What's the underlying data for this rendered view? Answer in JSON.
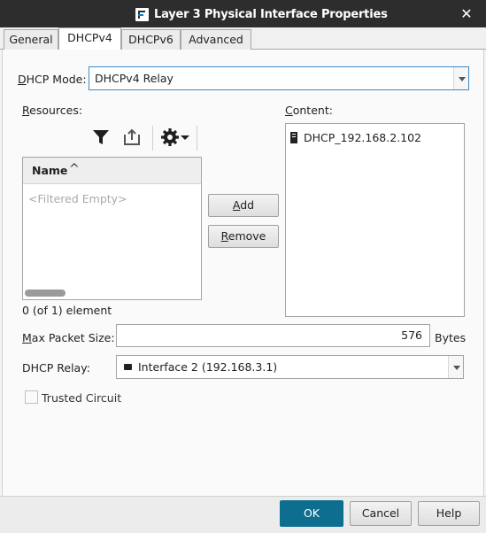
{
  "window": {
    "title": "Layer 3 Physical Interface Properties",
    "close_glyph": "✕"
  },
  "tabs": [
    {
      "label": "General",
      "active": false
    },
    {
      "label": "DHCPv4",
      "active": true
    },
    {
      "label": "DHCPv6",
      "active": false
    },
    {
      "label": "Advanced",
      "active": false
    }
  ],
  "dhcp_mode": {
    "label_prefix": "D",
    "label_rest": "HCP Mode:",
    "value": "DHCPv4 Relay"
  },
  "resources": {
    "label_prefix": "R",
    "label_rest": "esources:",
    "toolbar_icons": [
      "filter-icon",
      "export-icon",
      "gear-icon",
      "chevron-down-icon"
    ],
    "column_header": "Name",
    "sort_glyph": "^",
    "empty_text": "<Filtered Empty>",
    "count_text": "0 (of 1) element"
  },
  "actions": {
    "add_prefix": "A",
    "add_rest": "dd",
    "remove_prefix": "R",
    "remove_rest": "emove"
  },
  "content": {
    "label_prefix": "C",
    "label_rest": "ontent:",
    "items": [
      "DHCP_192.168.2.102"
    ],
    "item_icon": "server-icon"
  },
  "max_packet": {
    "label_prefix": "M",
    "label_rest": "ax Packet Size:",
    "value": "576",
    "unit": "Bytes"
  },
  "dhcp_relay": {
    "label": "DHCP Relay:",
    "value": "Interface 2 (192.168.3.1)",
    "icon": "interface-icon"
  },
  "trusted_circuit": {
    "label": "Trusted Circuit",
    "checked": false
  },
  "footer": {
    "ok": "OK",
    "cancel": "Cancel",
    "help": "Help"
  },
  "colors": {
    "titlebar": "#2d2d2d",
    "primary_button": "#0d6e8f",
    "focus": "#3f88c5"
  }
}
